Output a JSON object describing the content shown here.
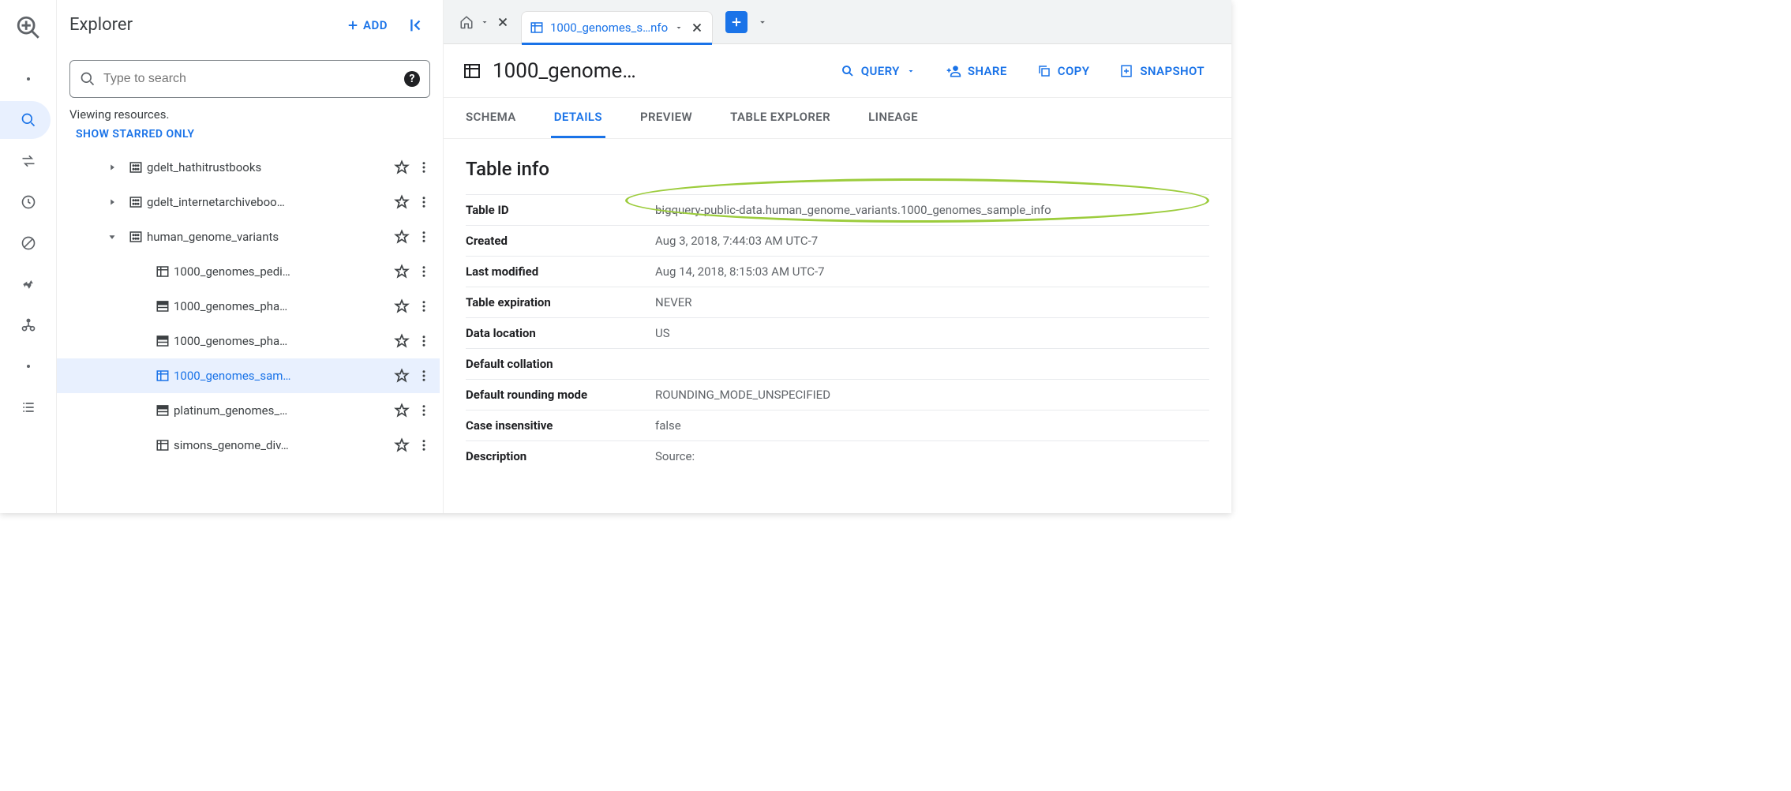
{
  "explorer": {
    "title": "Explorer",
    "add_label": "ADD",
    "search_placeholder": "Type to search",
    "viewing_text": "Viewing resources.",
    "starred_link": "SHOW STARRED ONLY",
    "tree": [
      {
        "label": "gdelt_hathitrustbooks",
        "depth": 1,
        "kind": "dataset",
        "expand": "collapsed"
      },
      {
        "label": "gdelt_internetarchiveboo…",
        "depth": 1,
        "kind": "dataset",
        "expand": "collapsed"
      },
      {
        "label": "human_genome_variants",
        "depth": 1,
        "kind": "dataset",
        "expand": "expanded"
      },
      {
        "label": "1000_genomes_pedi…",
        "depth": 2,
        "kind": "table",
        "expand": "none"
      },
      {
        "label": "1000_genomes_pha…",
        "depth": 2,
        "kind": "view",
        "expand": "none"
      },
      {
        "label": "1000_genomes_pha…",
        "depth": 2,
        "kind": "view",
        "expand": "none"
      },
      {
        "label": "1000_genomes_sam…",
        "depth": 2,
        "kind": "table",
        "expand": "none",
        "selected": true
      },
      {
        "label": "platinum_genomes_…",
        "depth": 2,
        "kind": "view",
        "expand": "none"
      },
      {
        "label": "simons_genome_div…",
        "depth": 2,
        "kind": "table",
        "expand": "none"
      }
    ]
  },
  "tabstrip": {
    "active_tab_label": "1000_genomes_s…nfo"
  },
  "titlebar": {
    "title": "1000_genome…",
    "actions": {
      "query": "QUERY",
      "share": "SHARE",
      "copy": "COPY",
      "snapshot": "SNAPSHOT"
    }
  },
  "subtabs": [
    "SCHEMA",
    "DETAILS",
    "PREVIEW",
    "TABLE EXPLORER",
    "LINEAGE"
  ],
  "subtabs_active_index": 1,
  "details": {
    "section_title": "Table info",
    "rows": [
      {
        "key": "Table ID",
        "value": "bigquery-public-data.human_genome_variants.1000_genomes_sample_info"
      },
      {
        "key": "Created",
        "value": "Aug 3, 2018, 7:44:03 AM UTC-7"
      },
      {
        "key": "Last modified",
        "value": "Aug 14, 2018, 8:15:03 AM UTC-7"
      },
      {
        "key": "Table expiration",
        "value": "NEVER"
      },
      {
        "key": "Data location",
        "value": "US"
      },
      {
        "key": "Default collation",
        "value": ""
      },
      {
        "key": "Default rounding mode",
        "value": "ROUNDING_MODE_UNSPECIFIED"
      },
      {
        "key": "Case insensitive",
        "value": "false"
      },
      {
        "key": "Description",
        "value": "Source:"
      }
    ]
  }
}
